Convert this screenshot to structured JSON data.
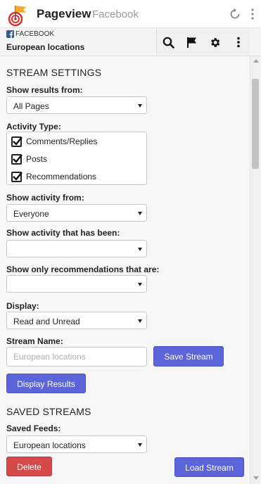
{
  "app": {
    "title": "Pageview",
    "subtitle": "Facebook"
  },
  "stream": {
    "network_label": "FACEBOOK",
    "title": "European locations"
  },
  "toolbar": {
    "icons": [
      "search-icon",
      "flag-icon",
      "gear-icon",
      "more-vertical-icon"
    ]
  },
  "stream_settings": {
    "heading": "STREAM SETTINGS",
    "show_results_from": {
      "label": "Show results from:",
      "value": "All Pages"
    },
    "activity_type": {
      "label": "Activity Type:",
      "options": [
        {
          "label": "Comments/Replies",
          "checked": true
        },
        {
          "label": "Posts",
          "checked": true
        },
        {
          "label": "Recommendations",
          "checked": true
        }
      ]
    },
    "show_activity_from": {
      "label": "Show activity from:",
      "value": "Everyone"
    },
    "show_activity_that_has_been": {
      "label": "Show activity that has been:",
      "value": ""
    },
    "show_only_recommendations": {
      "label": "Show only recommendations that are:",
      "value": ""
    },
    "display": {
      "label": "Display:",
      "value": "Read and Unread"
    },
    "stream_name": {
      "label": "Stream Name:",
      "placeholder": "European locations"
    },
    "save_stream_button": "Save Stream",
    "display_results_button": "Display Results"
  },
  "saved_streams": {
    "heading": "SAVED STREAMS",
    "saved_feeds": {
      "label": "Saved Feeds:",
      "value": "European locations"
    },
    "delete_button": "Delete",
    "load_stream_button": "Load Stream"
  },
  "colors": {
    "primary_button": "#5b64d8",
    "danger_button": "#d44a4a",
    "facebook_blue": "#3b5998",
    "logo_orange": "#f5a623",
    "logo_red": "#d9302c"
  }
}
